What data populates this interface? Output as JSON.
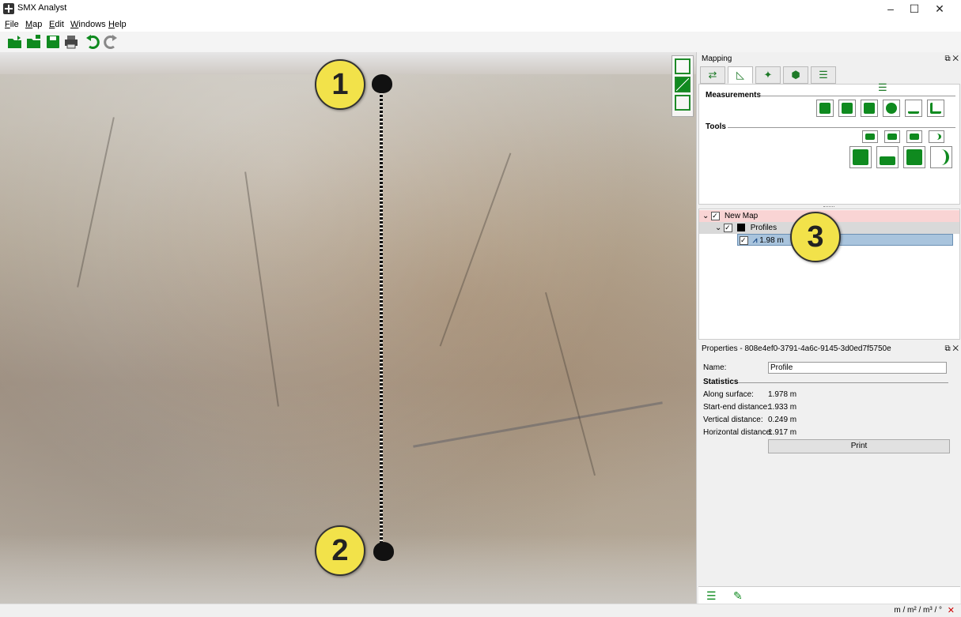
{
  "window": {
    "title": "SMX Analyst"
  },
  "menu": [
    {
      "pre": "",
      "u": "F",
      "post": "ile"
    },
    {
      "pre": "",
      "u": "M",
      "post": "ap"
    },
    {
      "pre": "",
      "u": "E",
      "post": "dit"
    },
    {
      "pre": "",
      "u": "W",
      "post": "indows"
    },
    {
      "pre": "",
      "u": "H",
      "post": "elp"
    }
  ],
  "toolbar": [
    "open-folder-icon",
    "import-icon",
    "save-icon",
    "print-icon",
    "undo-icon",
    "redo-icon"
  ],
  "callouts": [
    "1",
    "2",
    "3"
  ],
  "mapping": {
    "title": "Mapping",
    "tabs": [
      "mapping-icon",
      "measure-icon",
      "tree-icon",
      "shape-icon",
      "settings-icon"
    ],
    "measurements_label": "Measurements",
    "tools_label": "Tools"
  },
  "tree": {
    "root": "New Map",
    "group": "Profiles",
    "item": "1.98 m"
  },
  "properties": {
    "title": "Properties - 808e4ef0-3791-4a6c-9145-3d0ed7f5750e",
    "name_label": "Name:",
    "name_value": "Profile",
    "statistics_label": "Statistics",
    "rows": [
      {
        "label": "Along surface:",
        "value": "1.978 m"
      },
      {
        "label": "Start-end distance:",
        "value": "1.933 m"
      },
      {
        "label": "Vertical distance:",
        "value": "0.249 m"
      },
      {
        "label": "Horizontal distance:",
        "value": "1.917 m"
      }
    ],
    "print_label": "Print"
  },
  "status": {
    "units": "m / m² / m³ / °"
  },
  "colors": {
    "accent": "#0f8a1f",
    "callout": "#f2e24a",
    "selected_row": "#a9c4dd",
    "root_row": "#f9d4d4"
  }
}
